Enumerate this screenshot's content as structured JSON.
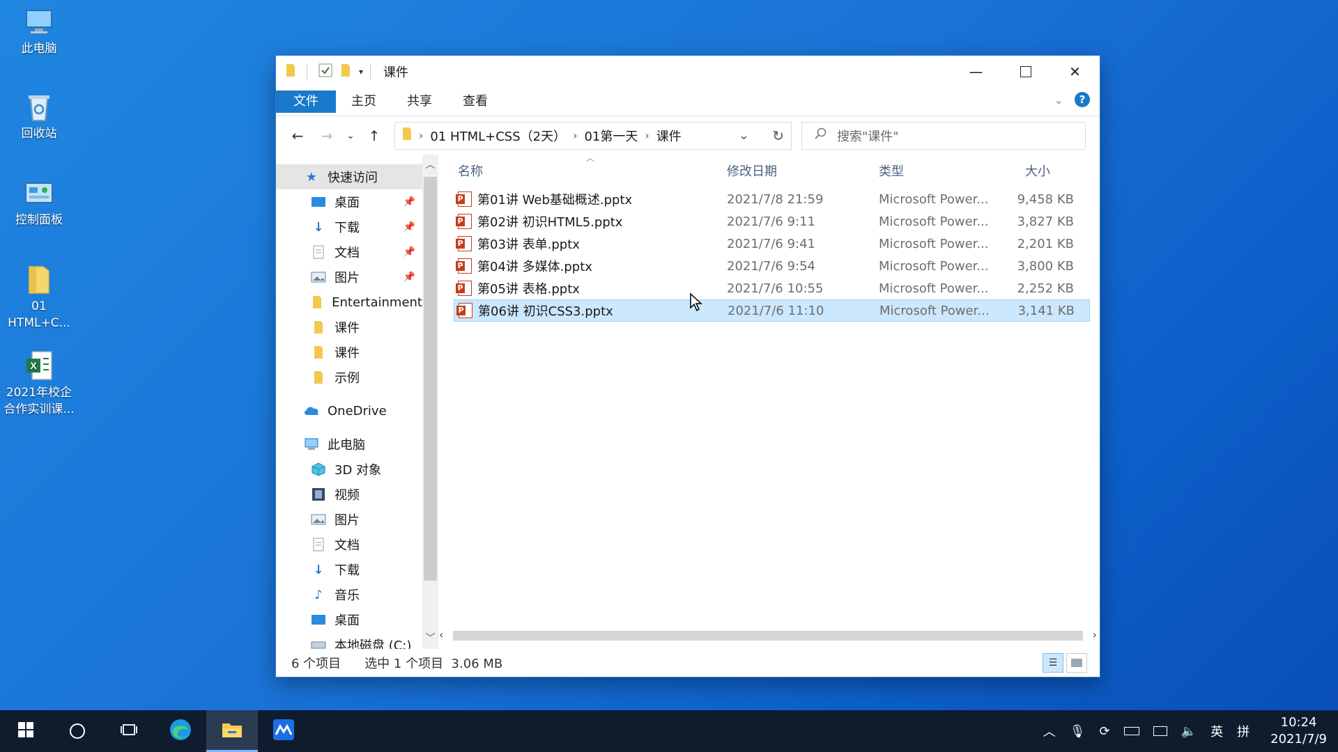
{
  "desktop": {
    "icons": [
      {
        "label1": "此电脑",
        "label2": ""
      },
      {
        "label1": "回收站",
        "label2": ""
      },
      {
        "label1": "控制面板",
        "label2": ""
      },
      {
        "label1": "01",
        "label2": "HTML+C..."
      },
      {
        "label1": "2021年校企",
        "label2": "合作实训课..."
      }
    ]
  },
  "window": {
    "title": "课件",
    "ribbon_tabs": [
      "文件",
      "主页",
      "共享",
      "查看"
    ],
    "help_label": "?",
    "breadcrumb": [
      "01 HTML+CSS（2天）",
      "01第一天",
      "课件"
    ],
    "search_placeholder": "搜索\"课件\""
  },
  "nav": {
    "quick_access": "快速访问",
    "quick_items": [
      {
        "label": "桌面",
        "icon": "desktop-icon",
        "pinned": true
      },
      {
        "label": "下载",
        "icon": "download-icon",
        "pinned": true
      },
      {
        "label": "文档",
        "icon": "document-icon",
        "pinned": true
      },
      {
        "label": "图片",
        "icon": "picture-icon",
        "pinned": true
      },
      {
        "label": "Entertainment",
        "icon": "folder-icon",
        "pinned": false
      },
      {
        "label": "课件",
        "icon": "folder-icon",
        "pinned": false
      },
      {
        "label": "课件",
        "icon": "folder-icon",
        "pinned": false
      },
      {
        "label": "示例",
        "icon": "folder-icon",
        "pinned": false
      }
    ],
    "onedrive": "OneDrive",
    "this_pc": "此电脑",
    "pc_items": [
      {
        "label": "3D 对象",
        "icon": "3d-objects-icon"
      },
      {
        "label": "视频",
        "icon": "video-icon"
      },
      {
        "label": "图片",
        "icon": "picture-icon"
      },
      {
        "label": "文档",
        "icon": "document-icon"
      },
      {
        "label": "下载",
        "icon": "download-icon"
      },
      {
        "label": "音乐",
        "icon": "music-icon"
      },
      {
        "label": "桌面",
        "icon": "desktop-icon"
      },
      {
        "label": "本地磁盘 (C:)",
        "icon": "drive-icon"
      }
    ]
  },
  "files": {
    "columns": {
      "name": "名称",
      "date": "修改日期",
      "type": "类型",
      "size": "大小"
    },
    "rows": [
      {
        "name": "第01讲 Web基础概述.pptx",
        "date": "2021/7/8 21:59",
        "type": "Microsoft Power...",
        "size": "9,458 KB",
        "selected": false
      },
      {
        "name": "第02讲 初识HTML5.pptx",
        "date": "2021/7/6 9:11",
        "type": "Microsoft Power...",
        "size": "3,827 KB",
        "selected": false
      },
      {
        "name": "第03讲 表单.pptx",
        "date": "2021/7/6 9:41",
        "type": "Microsoft Power...",
        "size": "2,201 KB",
        "selected": false
      },
      {
        "name": "第04讲 多媒体.pptx",
        "date": "2021/7/6 9:54",
        "type": "Microsoft Power...",
        "size": "3,800 KB",
        "selected": false
      },
      {
        "name": "第05讲 表格.pptx",
        "date": "2021/7/6 10:55",
        "type": "Microsoft Power...",
        "size": "2,252 KB",
        "selected": false
      },
      {
        "name": "第06讲 初识CSS3.pptx",
        "date": "2021/7/6 11:10",
        "type": "Microsoft Power...",
        "size": "3,141 KB",
        "selected": true
      }
    ]
  },
  "status": {
    "item_count": "6 个项目",
    "selection": "选中 1 个项目  3.06 MB"
  },
  "taskbar": {
    "ime_lang": "英",
    "ime_mode": "拼",
    "time": "10:24",
    "date": "2021/7/9"
  },
  "colors": {
    "accent": "#1979ca",
    "selection": "#cce8ff",
    "taskbar": "#0f1c2e"
  }
}
